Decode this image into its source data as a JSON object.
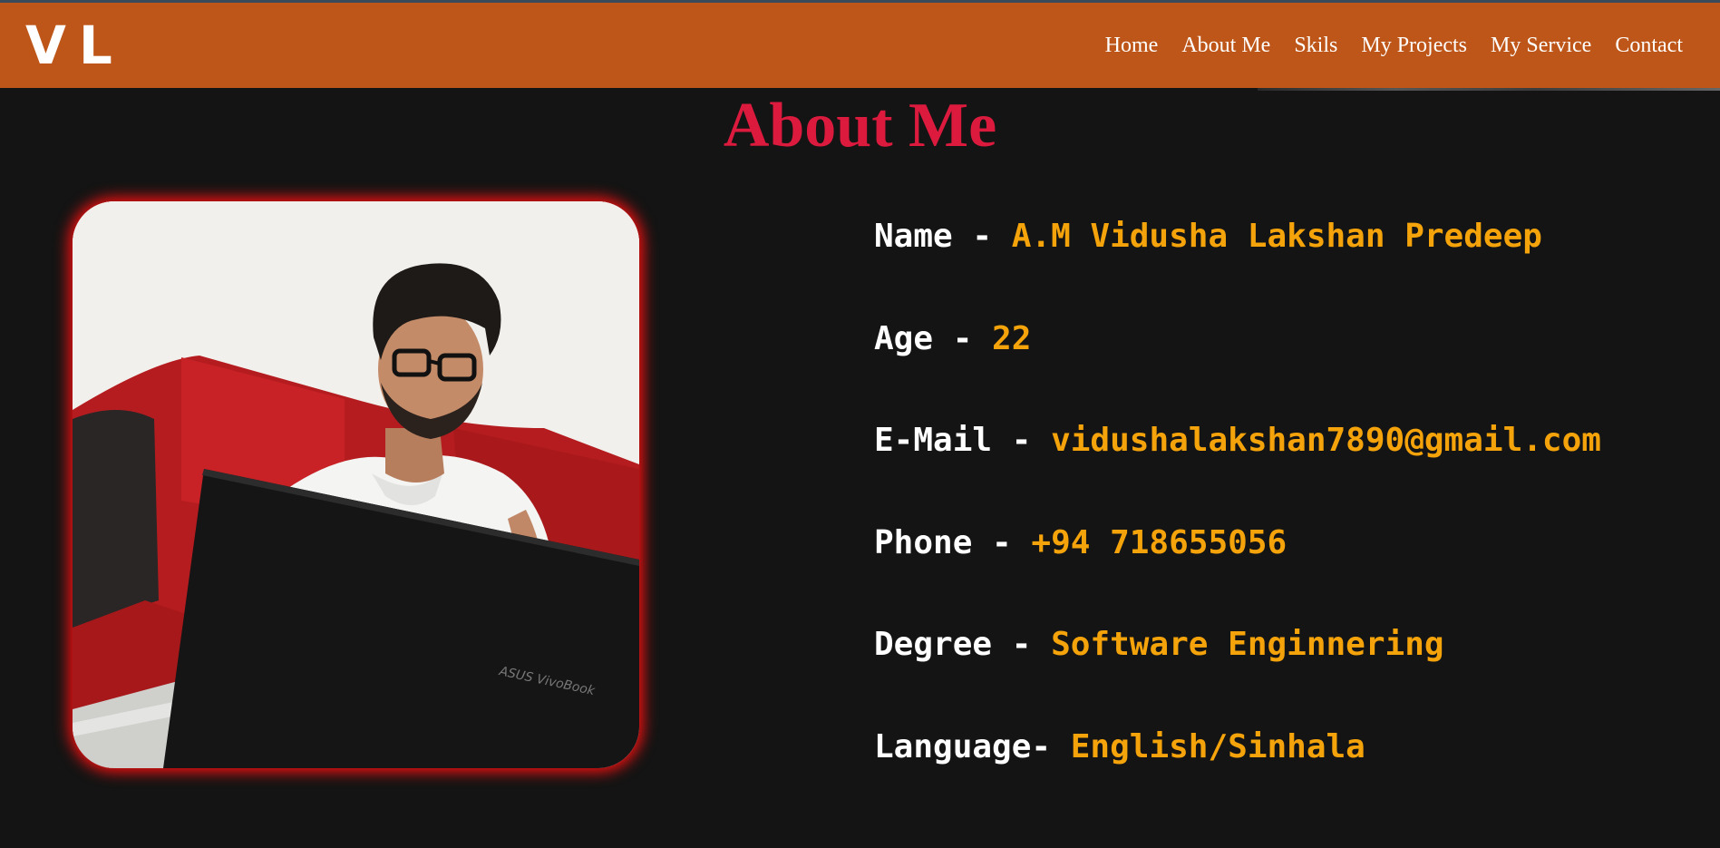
{
  "logo": "VL",
  "nav": {
    "items": [
      "Home",
      "About Me",
      "Skils",
      "My Projects",
      "My Service",
      "Contact"
    ]
  },
  "about": {
    "title": "About Me",
    "rows": [
      {
        "label": "Name - ",
        "value": "A.M Vidusha Lakshan Predeep"
      },
      {
        "label": "Age - ",
        "value": "22"
      },
      {
        "label": "E-Mail - ",
        "value": "vidushalakshan7890@gmail.com"
      },
      {
        "label": "Phone - ",
        "value": "+94 718655056"
      },
      {
        "label": "Degree - ",
        "value": "Software Enginnering"
      },
      {
        "label": "Language- ",
        "value": "English/Sinhala"
      }
    ]
  },
  "photo": {
    "laptop_brand": "ASUS VivoBook"
  },
  "colors": {
    "navbar": "#bd5618",
    "background": "#141414",
    "title": "#dc1a3e",
    "value": "#f5a30b",
    "label": "#ffffff",
    "photo_glow": "#ff1010"
  }
}
